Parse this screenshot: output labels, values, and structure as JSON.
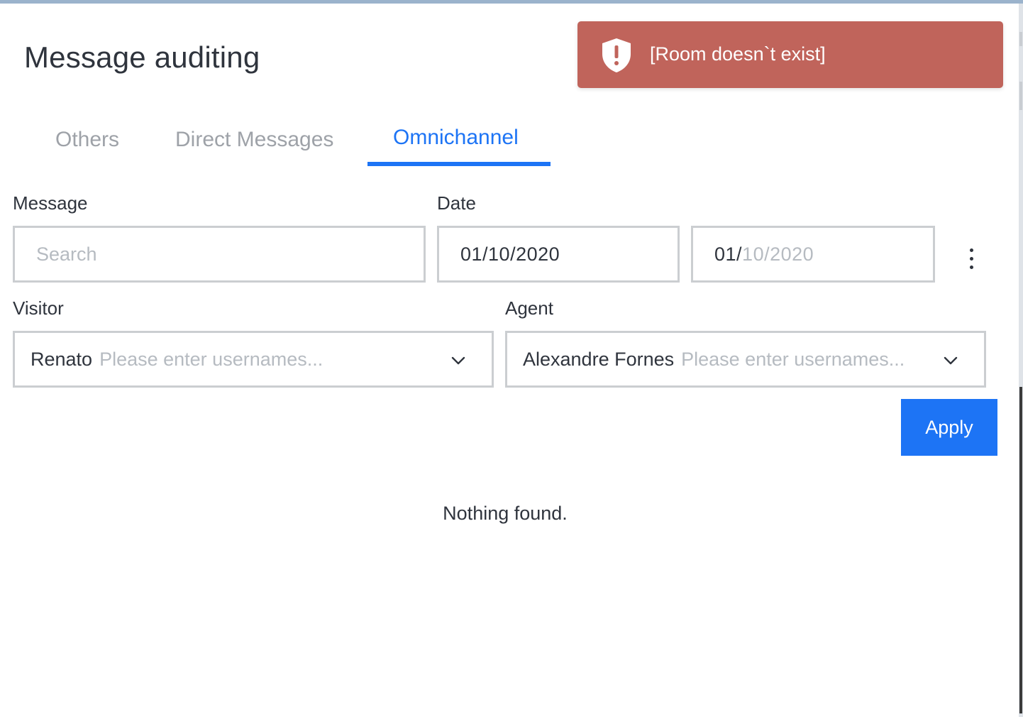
{
  "dialog": {
    "title": "Message auditing"
  },
  "tabs": [
    {
      "label": "Others",
      "active": false
    },
    {
      "label": "Direct Messages",
      "active": false
    },
    {
      "label": "Omnichannel",
      "active": true
    }
  ],
  "filters": {
    "message": {
      "label": "Message",
      "value": "",
      "placeholder": "Search"
    },
    "date": {
      "label": "Date",
      "start": "01/10/2020",
      "end_prefix": "01/",
      "end_month": "10",
      "end_sep": "/",
      "end_year": "2020"
    },
    "visitor": {
      "label": "Visitor",
      "selected": "Renato",
      "placeholder": "Please enter usernames..."
    },
    "agent": {
      "label": "Agent",
      "selected": "Alexandre Fornes",
      "placeholder": "Please enter usernames..."
    }
  },
  "actions": {
    "apply_label": "Apply"
  },
  "results": {
    "empty_text": "Nothing found."
  },
  "toast": {
    "message": "[Room doesn`t exist]",
    "type": "error",
    "icon": "shield-alert-icon",
    "color": "#c0645b"
  },
  "colors": {
    "accent": "#1d74f5",
    "text": "#2f343d",
    "muted": "#9ea2a8",
    "border": "#cbced1"
  }
}
